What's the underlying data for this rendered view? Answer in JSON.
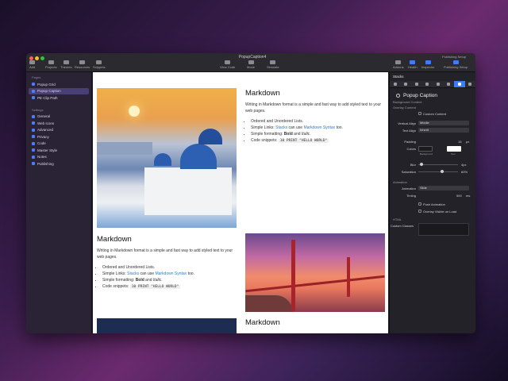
{
  "window": {
    "title": "PopupCaption4",
    "toolbar": {
      "add": "Add",
      "projects": "Projects",
      "themes": "Themes",
      "resources": "Resources",
      "snippets": "Snippets",
      "view_code": "View Code",
      "mode": "Mode",
      "simulate": "Simulate",
      "addons": "Addons",
      "health": "Health",
      "inspector": "Inspector",
      "publishing_setup": "Publishing Setup",
      "publishing_setup_top": "Publishing Setup"
    }
  },
  "sidebar": {
    "pages_label": "Pages",
    "pages": [
      {
        "label": "Popup Grid",
        "selected": false
      },
      {
        "label": "Popup Caption",
        "selected": true
      },
      {
        "label": "PE Clip Path",
        "selected": false
      }
    ],
    "settings_label": "Settings",
    "settings": [
      {
        "label": "General"
      },
      {
        "label": "Web Icons"
      },
      {
        "label": "Advanced"
      },
      {
        "label": "Privacy"
      },
      {
        "label": "Code"
      },
      {
        "label": "Master Style"
      },
      {
        "label": "Notes"
      },
      {
        "label": "Publishing"
      }
    ]
  },
  "content": {
    "heading": "Markdown",
    "paragraph": "Writing in Markdown format is a simple and fast way to add styled text to your web pages.",
    "list": {
      "item1": "Ordered and Unordered Lists.",
      "item2_prefix": "Simple Links: ",
      "item2_link1": "Stacks",
      "item2_middle": " can use ",
      "item2_link2": "Markdown Syntax",
      "item2_suffix": " too.",
      "item3_prefix": "Simple formatting: ",
      "item3_bold": "Bold",
      "item3_middle": " and ",
      "item3_italic": "Italic",
      "item3_suffix": ".",
      "item4_prefix": "Code snippets: ",
      "item4_code": "10 PRINT \"HELLO WORLD\""
    }
  },
  "inspector": {
    "header": "Stacks",
    "title": "Popup Caption",
    "background_content": "Background Content",
    "overlay_content": "Overlay Content",
    "custom_content": "Custom Content",
    "vertical_align_label": "Vertical Align",
    "vertical_align_value": "Middle",
    "text_align_label": "Text Align",
    "text_align_value": "Inherit",
    "padding_label": "Padding",
    "padding_value": "15",
    "padding_unit": "px",
    "colors_label": "Colors",
    "background_swatch_label": "Background",
    "text_swatch_label": "Text",
    "blur_label": "Blur",
    "blur_value": "4px",
    "saturation_label": "Saturation",
    "saturation_value": "60%",
    "animation_section": "Animation",
    "animation_label": "Animation",
    "animation_value": "Slide",
    "timing_label": "Timing",
    "timing_value": "500",
    "timing_unit": "ms",
    "push_animation": "Push Animation",
    "overlay_visible": "Overlay Visible on Load",
    "html_section": "HTML",
    "custom_classes_label": "Custom Classes"
  },
  "colors": {
    "accent": "#3d7bf7",
    "sidebar_bg": "#2a2336",
    "selected_bg": "#4a3f74",
    "link": "#2a7bd6"
  }
}
